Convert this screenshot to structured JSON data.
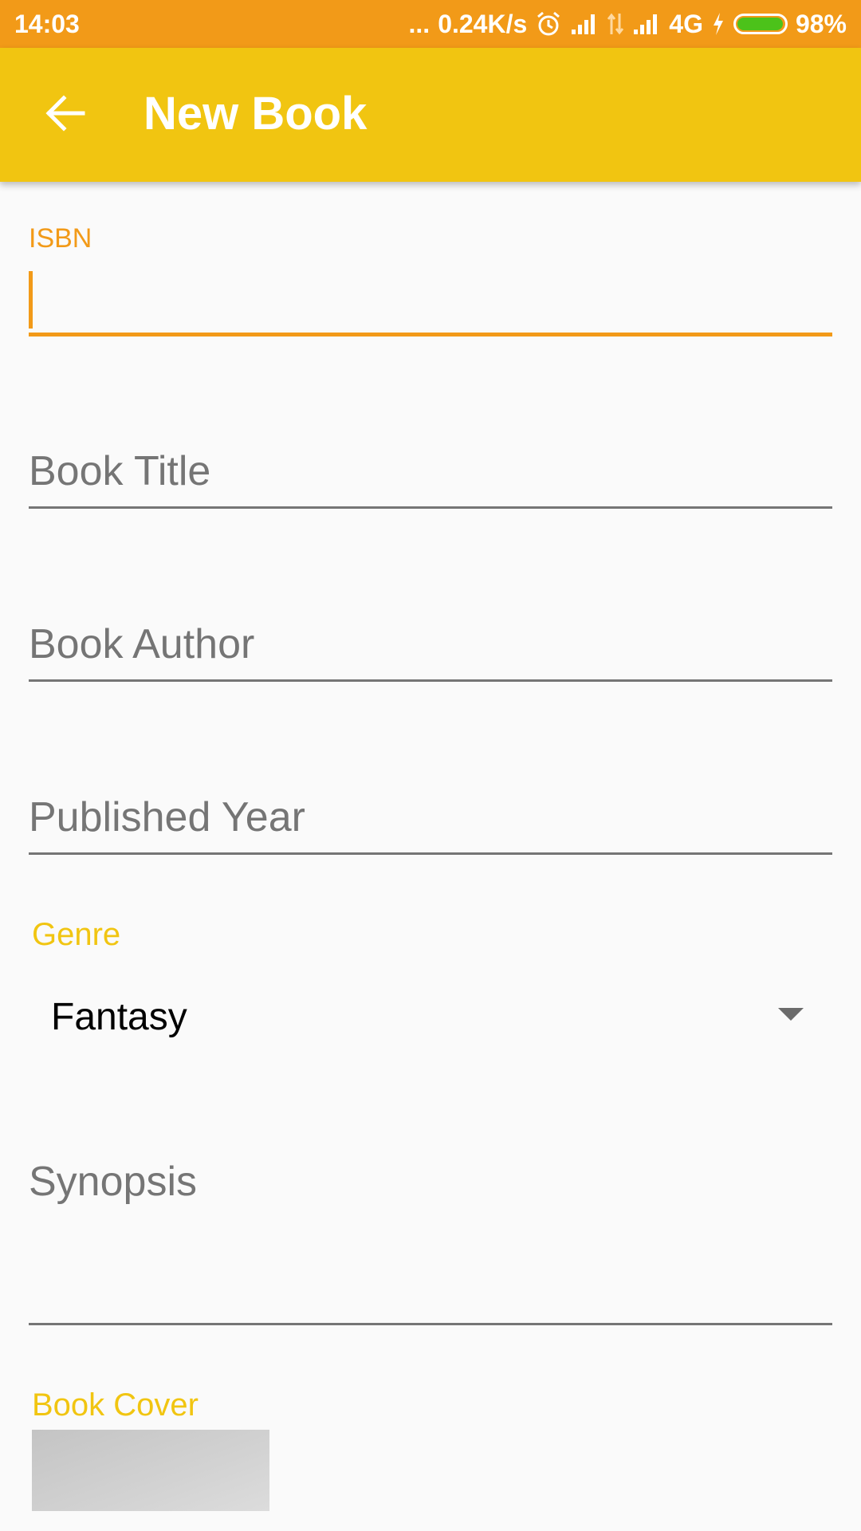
{
  "status_bar": {
    "time": "14:03",
    "dots": "...",
    "network_speed": "0.24K/s",
    "network_type": "4G",
    "battery_percent": "98%",
    "battery_level": 0.98,
    "icons": [
      "alarm-icon",
      "signal-icon",
      "data-transfer-icon",
      "signal-icon",
      "charging-icon",
      "battery-icon"
    ]
  },
  "app_bar": {
    "title": "New Book",
    "back_icon": "arrow-back-icon",
    "background_color": "#F1C511"
  },
  "form": {
    "isbn": {
      "floating_label": "ISBN",
      "value": ""
    },
    "title": {
      "placeholder": "Book Title",
      "value": ""
    },
    "author": {
      "placeholder": "Book Author",
      "value": ""
    },
    "published_year": {
      "placeholder": "Published Year",
      "value": ""
    },
    "genre": {
      "label": "Genre",
      "selected": "Fantasy"
    },
    "synopsis": {
      "placeholder": "Synopsis",
      "value": ""
    },
    "cover": {
      "label": "Book Cover"
    }
  },
  "colors": {
    "status_bar": "#F29A18",
    "accent": "#F29A18",
    "label_yellow": "#F1C511",
    "hint_gray": "#757575"
  }
}
